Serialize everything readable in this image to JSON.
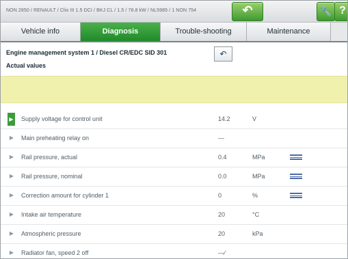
{
  "window": {
    "title_text": "NON 2850 / RENAULT / Clio III 1.5 DCI / BKJ CL / 1.5 / 78.8 kW / NL5985 / 1 NON 754",
    "back_icon": "back-arrow-icon",
    "wrench_icon": "wrench-icon",
    "help_label": "?"
  },
  "tabs": [
    {
      "label": "Vehicle info",
      "active": false
    },
    {
      "label": "Diagnosis",
      "active": true
    },
    {
      "label": "Trouble-shooting",
      "active": false
    },
    {
      "label": "Maintenance",
      "active": false
    }
  ],
  "content": {
    "system_title": "Engine management system 1 / Diesel CR/EDC SID 301",
    "subtitle": "Actual values",
    "small_back_icon": "return-icon"
  },
  "rows": [
    {
      "label": "Supply voltage for control unit",
      "value": "14.2",
      "unit": "V",
      "graph": false,
      "active": true
    },
    {
      "label": "Main preheating relay on",
      "value": "—",
      "unit": "",
      "graph": false,
      "active": false
    },
    {
      "label": "Rail pressure, actual",
      "value": "0.4",
      "unit": "MPa",
      "graph": true,
      "active": false
    },
    {
      "label": "Rail pressure, nominal",
      "value": "0.0",
      "unit": "MPa",
      "graph": true,
      "active": false
    },
    {
      "label": "Correction amount for cylinder 1",
      "value": "0",
      "unit": "%",
      "graph": true,
      "active": false
    },
    {
      "label": "Intake air temperature",
      "value": "20",
      "unit": "°C",
      "graph": false,
      "active": false
    },
    {
      "label": "Atmospheric pressure",
      "value": "20",
      "unit": "kPa",
      "graph": false,
      "active": false
    },
    {
      "label": "Radiator fan, speed 2 off",
      "value": "—∕",
      "unit": "",
      "graph": false,
      "active": false
    }
  ]
}
